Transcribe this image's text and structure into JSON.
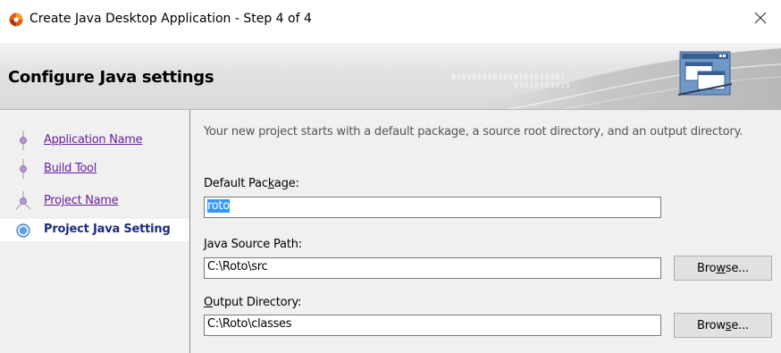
{
  "window": {
    "title": "Create Java Desktop Application - Step 4 of 4",
    "close_glyph": "✕"
  },
  "header": {
    "title": "Configure Java settings",
    "binary_line1": "0101010101010101010101",
    "binary_line2": "01010101010"
  },
  "steps": [
    {
      "label": "Application Name",
      "state": "visited"
    },
    {
      "label": "Build Tool",
      "state": "visited"
    },
    {
      "label": "Project Name",
      "state": "visited"
    },
    {
      "label": "Project Java Setting",
      "state": "active"
    }
  ],
  "main": {
    "intro": "Your new project starts with a default package, a source root directory, and an output directory.",
    "default_package": {
      "label_pre": "Default Pac",
      "label_mn": "k",
      "label_post": "age:",
      "value": "roto"
    },
    "java_source_path": {
      "label_pre": "",
      "label_mn": "J",
      "label_post": "ava Source Path:",
      "value": "C:\\Roto\\src",
      "browse_pre": "Bro",
      "browse_mn": "w",
      "browse_post": "se..."
    },
    "output_directory": {
      "label_pre": "",
      "label_mn": "O",
      "label_post": "utput Directory:",
      "value": "C:\\Roto\\classes",
      "browse_pre": "Brow",
      "browse_mn": "s",
      "browse_post": "e..."
    }
  },
  "colors": {
    "visited_link": "#6a1f9a",
    "active_step": "#1a2a7a",
    "selection": "#3399ff"
  }
}
